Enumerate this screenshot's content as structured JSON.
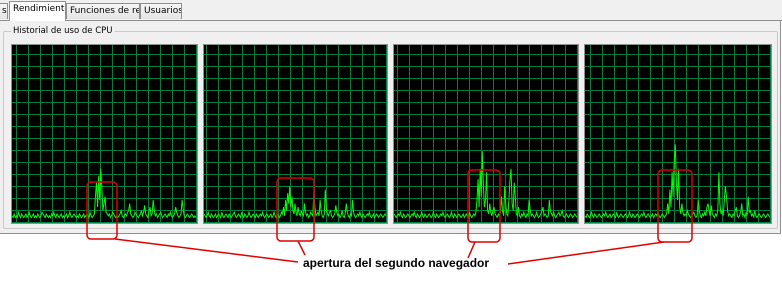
{
  "tabs": [
    {
      "label": "s"
    },
    {
      "label": "Rendimiento"
    },
    {
      "label": "Funciones de red"
    },
    {
      "label": "Usuarios"
    }
  ],
  "active_tab": "Rendimiento",
  "group_title": "Historial de uso de CPU",
  "annotation": "apertura del segundo navegador",
  "colors": {
    "graph_bg": "#000000",
    "grid": "#008040",
    "line": "#00ff00",
    "highlight": "#e00000"
  },
  "chart_data": [
    {
      "type": "line",
      "title": "",
      "ylim": [
        0,
        100
      ],
      "grid": true,
      "values": [
        3,
        2,
        4,
        2,
        3,
        2,
        5,
        3,
        2,
        4,
        3,
        2,
        3,
        4,
        2,
        3,
        5,
        3,
        2,
        3,
        4,
        2,
        3,
        2,
        4,
        3,
        2,
        3,
        5,
        4,
        3,
        2,
        4,
        3,
        2,
        3,
        2,
        4,
        3,
        5,
        3,
        2,
        4,
        3,
        2,
        3,
        4,
        2,
        3,
        2,
        3,
        4,
        2,
        3,
        5,
        3,
        2,
        3,
        4,
        3,
        2,
        3,
        2,
        4,
        3,
        2,
        3,
        4,
        2,
        3,
        4,
        3,
        2,
        5,
        3,
        2,
        3,
        4,
        14,
        22,
        8,
        26,
        12,
        30,
        18,
        6,
        10,
        14,
        5,
        4,
        3,
        4,
        2,
        3,
        5,
        4,
        3,
        2,
        3,
        2,
        3,
        4,
        6,
        3,
        2,
        3,
        4,
        3,
        5,
        6,
        10,
        4,
        3,
        2,
        3,
        5,
        4,
        3,
        2,
        3,
        4,
        6,
        3,
        5,
        9,
        4,
        3,
        2,
        5,
        8,
        3,
        4,
        12,
        6,
        3,
        4,
        2,
        3,
        4,
        5,
        3,
        2,
        3,
        4,
        3,
        2,
        4,
        3,
        5,
        3,
        2,
        3,
        4,
        8,
        5,
        3,
        2,
        3,
        4,
        12,
        7,
        3,
        2,
        3,
        4,
        3,
        2,
        3,
        4,
        3,
        2,
        3,
        2
      ]
    },
    {
      "type": "line",
      "title": "",
      "ylim": [
        0,
        100
      ],
      "grid": true,
      "values": [
        4,
        3,
        2,
        3,
        5,
        3,
        2,
        4,
        3,
        2,
        3,
        4,
        2,
        3,
        4,
        3,
        2,
        5,
        3,
        2,
        3,
        4,
        3,
        2,
        4,
        3,
        2,
        3,
        4,
        5,
        3,
        2,
        3,
        4,
        3,
        2,
        5,
        3,
        2,
        4,
        3,
        2,
        3,
        5,
        3,
        2,
        3,
        4,
        3,
        2,
        4,
        3,
        2,
        3,
        4,
        3,
        5,
        3,
        2,
        3,
        4,
        3,
        2,
        3,
        4,
        2,
        3,
        5,
        3,
        2,
        4,
        3,
        2,
        3,
        5,
        4,
        8,
        3,
        12,
        6,
        16,
        10,
        20,
        8,
        14,
        6,
        4,
        10,
        5,
        3,
        8,
        4,
        3,
        6,
        4,
        3,
        10,
        5,
        3,
        4,
        2,
        3,
        5,
        4,
        3,
        16,
        8,
        3,
        4,
        5,
        3,
        12,
        6,
        3,
        2,
        4,
        18,
        8,
        4,
        3,
        5,
        6,
        3,
        2,
        3,
        4,
        9,
        5,
        3,
        4,
        2,
        3,
        6,
        3,
        2,
        4,
        10,
        5,
        3,
        2,
        4,
        3,
        12,
        5,
        3,
        2,
        3,
        4,
        3,
        5,
        3,
        2,
        4,
        3,
        2,
        3,
        4,
        3,
        5,
        3,
        2,
        3,
        4,
        2,
        3,
        4,
        3,
        2,
        3,
        4,
        3,
        2,
        3,
        4,
        3
      ]
    },
    {
      "type": "line",
      "title": "",
      "ylim": [
        0,
        100
      ],
      "grid": true,
      "values": [
        4,
        3,
        2,
        3,
        4,
        3,
        5,
        3,
        2,
        4,
        3,
        2,
        3,
        4,
        3,
        2,
        3,
        4,
        3,
        5,
        3,
        2,
        4,
        3,
        2,
        3,
        5,
        3,
        2,
        4,
        3,
        2,
        3,
        4,
        3,
        2,
        3,
        5,
        3,
        2,
        4,
        3,
        2,
        3,
        4,
        3,
        5,
        3,
        2,
        3,
        4,
        3,
        2,
        3,
        5,
        3,
        2,
        4,
        3,
        2,
        3,
        4,
        3,
        2,
        3,
        4,
        2,
        3,
        4,
        3,
        2,
        5,
        3,
        2,
        3,
        4,
        3,
        5,
        12,
        24,
        8,
        30,
        14,
        40,
        20,
        8,
        12,
        28,
        6,
        4,
        10,
        5,
        3,
        6,
        8,
        4,
        3,
        2,
        4,
        3,
        5,
        14,
        6,
        3,
        20,
        10,
        4,
        3,
        12,
        24,
        30,
        10,
        6,
        22,
        14,
        4,
        3,
        8,
        3,
        2,
        4,
        3,
        5,
        3,
        2,
        4,
        3,
        12,
        6,
        3,
        4,
        3,
        2,
        3,
        5,
        3,
        2,
        3,
        4,
        6,
        8,
        3,
        4,
        3,
        2,
        3,
        12,
        6,
        4,
        3,
        5,
        3,
        2,
        3,
        4,
        5,
        3,
        4,
        6,
        3,
        2,
        3,
        4,
        3,
        2,
        3,
        4,
        3,
        2,
        3,
        4,
        3,
        2
      ]
    },
    {
      "type": "line",
      "title": "",
      "ylim": [
        0,
        100
      ],
      "grid": true,
      "values": [
        3,
        2,
        4,
        3,
        2,
        3,
        5,
        3,
        2,
        4,
        3,
        2,
        3,
        4,
        3,
        2,
        3,
        4,
        3,
        5,
        3,
        2,
        3,
        4,
        2,
        3,
        4,
        3,
        2,
        5,
        3,
        2,
        3,
        4,
        3,
        2,
        3,
        4,
        3,
        2,
        3,
        5,
        3,
        2,
        4,
        3,
        2,
        3,
        4,
        3,
        2,
        3,
        4,
        3,
        5,
        3,
        2,
        3,
        4,
        3,
        2,
        3,
        4,
        2,
        3,
        4,
        3,
        5,
        3,
        2,
        3,
        4,
        3,
        2,
        3,
        4,
        10,
        4,
        18,
        8,
        28,
        14,
        34,
        44,
        22,
        12,
        30,
        8,
        4,
        10,
        5,
        3,
        4,
        3,
        6,
        4,
        3,
        2,
        3,
        4,
        5,
        3,
        2,
        3,
        12,
        6,
        3,
        2,
        4,
        3,
        5,
        3,
        8,
        10,
        6,
        3,
        9,
        4,
        3,
        2,
        4,
        3,
        6,
        28,
        10,
        4,
        6,
        3,
        12,
        20,
        14,
        6,
        3,
        4,
        3,
        2,
        4,
        3,
        6,
        8,
        3,
        2,
        3,
        5,
        10,
        3,
        4,
        2,
        5,
        3,
        14,
        5,
        6,
        3,
        4,
        2,
        6,
        3,
        2,
        3,
        4,
        3,
        2,
        3,
        4,
        3,
        2,
        3,
        4,
        3,
        2
      ]
    }
  ]
}
